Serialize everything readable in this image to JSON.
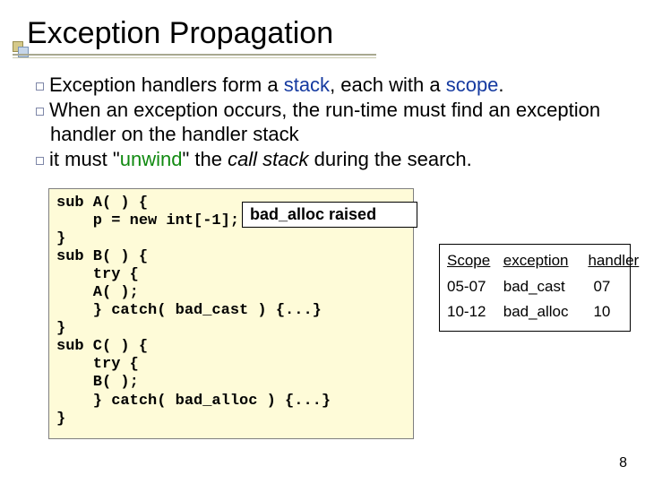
{
  "title": "Exception Propagation",
  "bullets": {
    "b1": {
      "pre": "Exception handlers form a ",
      "kw1": "stack",
      "mid": ", each with a ",
      "kw2": "scope",
      "post": "."
    },
    "b2": "When an exception occurs, the run-time must find an exception handler on the handler stack",
    "b3": {
      "pre": "it must \"",
      "kw": "unwind",
      "mid": "\" the ",
      "ital": "call stack",
      "post": " during the search."
    }
  },
  "code": "sub A( ) {\n    p = new int[-1];\n}\nsub B( ) {\n    try {\n    A( );\n    } catch( bad_cast ) {...}\n}\nsub C( ) {\n    try {\n    B( );\n    } catch( bad_alloc ) {...}\n}",
  "raised": "bad_alloc raised",
  "scope": {
    "headers": {
      "c1": "Scope",
      "c2": "exception",
      "c3": "handler"
    },
    "rows": [
      {
        "c1": "05-07",
        "c2": "bad_cast",
        "c3": "07"
      },
      {
        "c1": "10-12",
        "c2": "bad_alloc",
        "c3": "10"
      }
    ]
  },
  "page": "8"
}
